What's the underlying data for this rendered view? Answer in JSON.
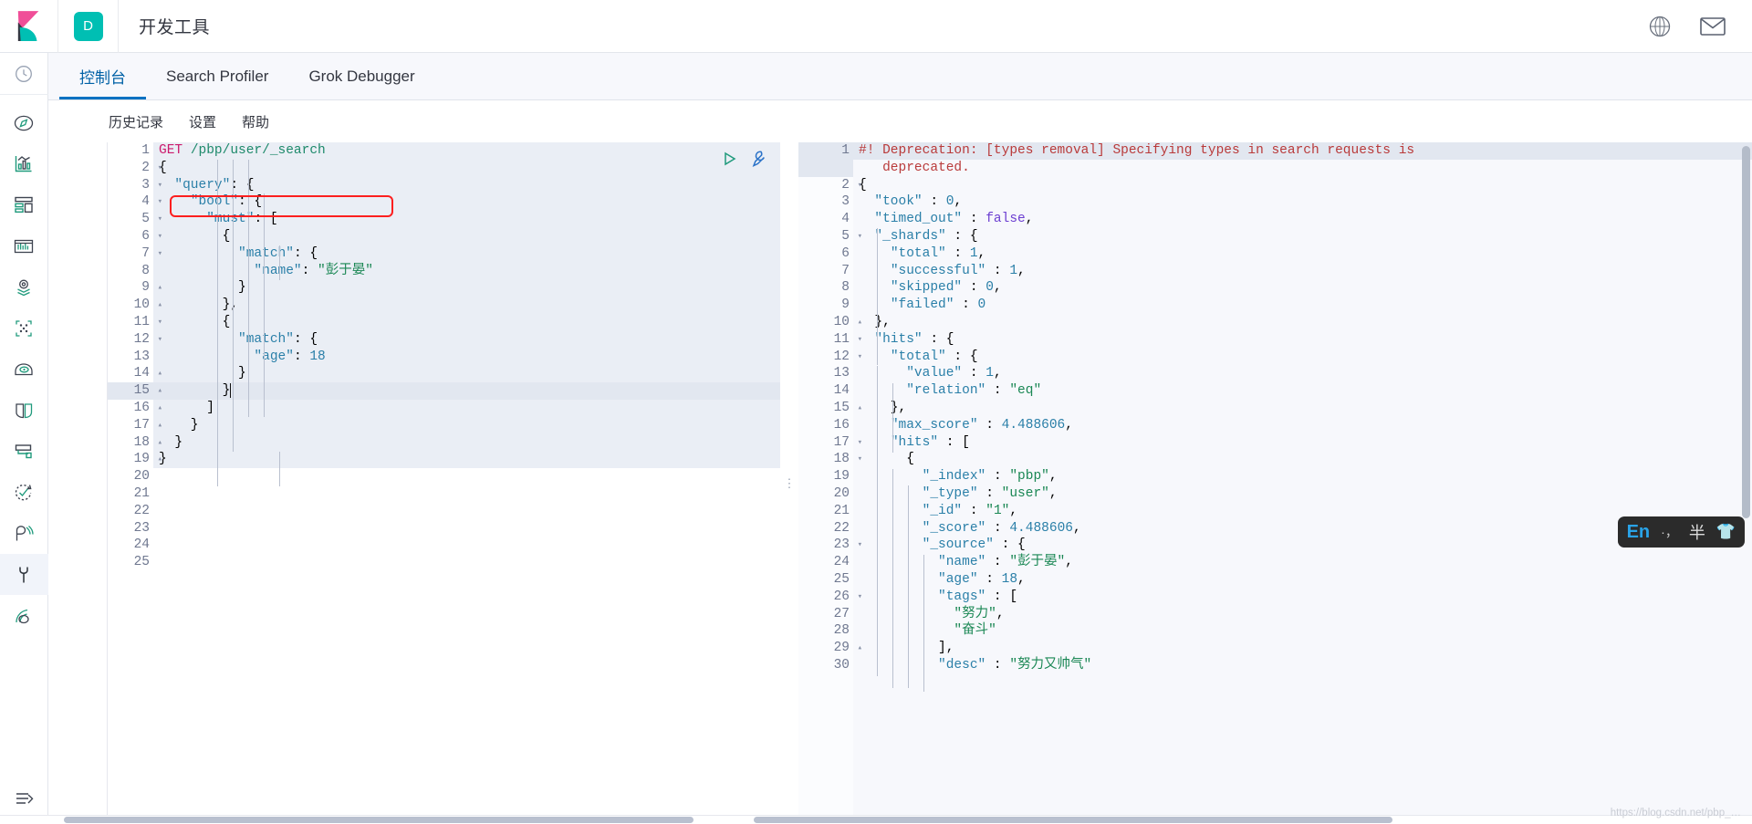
{
  "header": {
    "logo_icon": "kibana-logo",
    "space_badge": "D",
    "title": "开发工具",
    "help_icon": "help-circle-icon",
    "mail_icon": "mail-icon"
  },
  "sidebar": {
    "recent_icon": "clock-icon",
    "items": [
      {
        "icon": "discover-compass-icon",
        "name": "discover",
        "active": false
      },
      {
        "icon": "visualize-chart-icon",
        "name": "visualize",
        "active": false
      },
      {
        "icon": "dashboard-icon",
        "name": "dashboard",
        "active": false
      },
      {
        "icon": "canvas-icon",
        "name": "canvas",
        "active": false
      },
      {
        "icon": "maps-icon",
        "name": "maps",
        "active": false
      },
      {
        "icon": "machine-learning-icon",
        "name": "machine-learning",
        "active": false
      },
      {
        "icon": "infrastructure-icon",
        "name": "infrastructure",
        "active": false
      },
      {
        "icon": "logs-icon",
        "name": "logs",
        "active": false
      },
      {
        "icon": "apm-icon",
        "name": "apm",
        "active": false
      },
      {
        "icon": "uptime-icon",
        "name": "uptime",
        "active": false
      },
      {
        "icon": "siem-icon",
        "name": "siem",
        "active": false
      },
      {
        "icon": "dev-tools-wrench-icon",
        "name": "dev-tools",
        "active": true
      },
      {
        "icon": "monitoring-icon",
        "name": "monitoring",
        "active": false
      }
    ],
    "collapse_icon": "collapse-arrow-icon"
  },
  "tabs": [
    {
      "label": "控制台",
      "active": true
    },
    {
      "label": "Search Profiler",
      "active": false
    },
    {
      "label": "Grok Debugger",
      "active": false
    }
  ],
  "subbar": [
    {
      "label": "历史记录"
    },
    {
      "label": "设置"
    },
    {
      "label": "帮助"
    }
  ],
  "editor_actions": {
    "play_icon": "play-triangle-icon",
    "wrench_icon": "wrench-icon"
  },
  "request_editor": {
    "current_line": 15,
    "lines": [
      {
        "n": 1,
        "fold": "",
        "text": "GET /pbp/user/_search"
      },
      {
        "n": 2,
        "fold": "▾",
        "text": "{"
      },
      {
        "n": 3,
        "fold": "▾",
        "text": "  \"query\": {"
      },
      {
        "n": 4,
        "fold": "▾",
        "text": "    \"bool\": {"
      },
      {
        "n": 5,
        "fold": "▾",
        "text": "      \"must\": ["
      },
      {
        "n": 6,
        "fold": "▾",
        "text": "        {"
      },
      {
        "n": 7,
        "fold": "▾",
        "text": "          \"match\": {"
      },
      {
        "n": 8,
        "fold": "",
        "text": "            \"name\": \"彭于晏\""
      },
      {
        "n": 9,
        "fold": "▴",
        "text": "          }"
      },
      {
        "n": 10,
        "fold": "▴",
        "text": "        },"
      },
      {
        "n": 11,
        "fold": "▾",
        "text": "        {"
      },
      {
        "n": 12,
        "fold": "▾",
        "text": "          \"match\": {"
      },
      {
        "n": 13,
        "fold": "",
        "text": "            \"age\": 18"
      },
      {
        "n": 14,
        "fold": "▴",
        "text": "          }"
      },
      {
        "n": 15,
        "fold": "▴",
        "text": "        }"
      },
      {
        "n": 16,
        "fold": "▴",
        "text": "      ]"
      },
      {
        "n": 17,
        "fold": "▴",
        "text": "    }"
      },
      {
        "n": 18,
        "fold": "▴",
        "text": "  }"
      },
      {
        "n": 19,
        "fold": "▴",
        "text": "}"
      },
      {
        "n": 20,
        "fold": "",
        "text": ""
      },
      {
        "n": 21,
        "fold": "",
        "text": ""
      },
      {
        "n": 22,
        "fold": "",
        "text": ""
      },
      {
        "n": 23,
        "fold": "",
        "text": ""
      },
      {
        "n": 24,
        "fold": "",
        "text": ""
      },
      {
        "n": 25,
        "fold": "",
        "text": ""
      }
    ]
  },
  "response_editor": {
    "lines": [
      {
        "n": 1,
        "fold": "",
        "text": "#! Deprecation: [types removal] Specifying types in search requests is"
      },
      {
        "n": "",
        "fold": "",
        "text": "   deprecated."
      },
      {
        "n": 2,
        "fold": "▾",
        "text": "{"
      },
      {
        "n": 3,
        "fold": "",
        "text": "  \"took\" : 0,"
      },
      {
        "n": 4,
        "fold": "",
        "text": "  \"timed_out\" : false,"
      },
      {
        "n": 5,
        "fold": "▾",
        "text": "  \"_shards\" : {"
      },
      {
        "n": 6,
        "fold": "",
        "text": "    \"total\" : 1,"
      },
      {
        "n": 7,
        "fold": "",
        "text": "    \"successful\" : 1,"
      },
      {
        "n": 8,
        "fold": "",
        "text": "    \"skipped\" : 0,"
      },
      {
        "n": 9,
        "fold": "",
        "text": "    \"failed\" : 0"
      },
      {
        "n": 10,
        "fold": "▴",
        "text": "  },"
      },
      {
        "n": 11,
        "fold": "▾",
        "text": "  \"hits\" : {"
      },
      {
        "n": 12,
        "fold": "▾",
        "text": "    \"total\" : {"
      },
      {
        "n": 13,
        "fold": "",
        "text": "      \"value\" : 1,"
      },
      {
        "n": 14,
        "fold": "",
        "text": "      \"relation\" : \"eq\""
      },
      {
        "n": 15,
        "fold": "▴",
        "text": "    },"
      },
      {
        "n": 16,
        "fold": "",
        "text": "    \"max_score\" : 4.488606,"
      },
      {
        "n": 17,
        "fold": "▾",
        "text": "    \"hits\" : ["
      },
      {
        "n": 18,
        "fold": "▾",
        "text": "      {"
      },
      {
        "n": 19,
        "fold": "",
        "text": "        \"_index\" : \"pbp\","
      },
      {
        "n": 20,
        "fold": "",
        "text": "        \"_type\" : \"user\","
      },
      {
        "n": 21,
        "fold": "",
        "text": "        \"_id\" : \"1\","
      },
      {
        "n": 22,
        "fold": "",
        "text": "        \"_score\" : 4.488606,"
      },
      {
        "n": 23,
        "fold": "▾",
        "text": "        \"_source\" : {"
      },
      {
        "n": 24,
        "fold": "",
        "text": "          \"name\" : \"彭于晏\","
      },
      {
        "n": 25,
        "fold": "",
        "text": "          \"age\" : 18,"
      },
      {
        "n": 26,
        "fold": "▾",
        "text": "          \"tags\" : ["
      },
      {
        "n": 27,
        "fold": "",
        "text": "            \"努力\","
      },
      {
        "n": 28,
        "fold": "",
        "text": "            \"奋斗\""
      },
      {
        "n": 29,
        "fold": "▴",
        "text": "          ],"
      },
      {
        "n": 30,
        "fold": "",
        "text": "          \"desc\" : \"努力又帅气\""
      }
    ]
  },
  "annotation": {
    "type": "red-rectangle-highlight",
    "target_line": 4,
    "color": "#fc1f1f"
  },
  "ime_overlay": {
    "language": "En",
    "punctuation": "·，",
    "width_mode": "半",
    "skin_icon": "shirt-icon"
  },
  "watermark": "https://blog.csdn.net/pbp_…",
  "colors": {
    "accent_blue": "#0071c2",
    "space_teal": "#00bfb3",
    "method_pink": "#cc1a6c",
    "url_green": "#1e8a6b",
    "key_blue": "#2a7fa8",
    "string_green": "#1a8754",
    "bool_purple": "#6c3fd1",
    "warn_red": "#b93a3a",
    "annotation_red": "#fc1f1f"
  }
}
